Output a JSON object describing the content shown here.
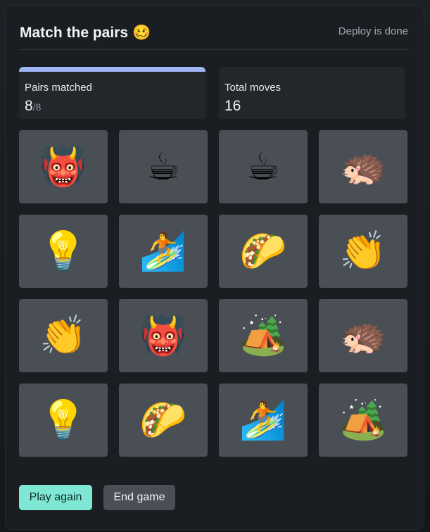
{
  "header": {
    "title": "Match the pairs",
    "title_emoji": "🥴",
    "status": "Deploy is done"
  },
  "stats": {
    "pairs_label": "Pairs matched",
    "pairs_value": "8",
    "pairs_total": "/8",
    "pairs_progress": 1.0,
    "moves_label": "Total moves",
    "moves_value": "16"
  },
  "tiles": [
    {
      "emoji": "👹",
      "icon": "ogre-icon"
    },
    {
      "emoji": "☕",
      "icon": "coffee-icon"
    },
    {
      "emoji": "☕",
      "icon": "coffee-icon"
    },
    {
      "emoji": "🦔",
      "icon": "hedgehog-icon"
    },
    {
      "emoji": "💡",
      "icon": "light-bulb-icon"
    },
    {
      "emoji": "🏄",
      "icon": "surfer-icon"
    },
    {
      "emoji": "🌮",
      "icon": "taco-icon"
    },
    {
      "emoji": "👏",
      "icon": "clapping-hands-icon"
    },
    {
      "emoji": "👏",
      "icon": "clapping-hands-icon"
    },
    {
      "emoji": "👹",
      "icon": "ogre-icon"
    },
    {
      "emoji": "🏕️",
      "icon": "camping-icon"
    },
    {
      "emoji": "🦔",
      "icon": "hedgehog-icon"
    },
    {
      "emoji": "💡",
      "icon": "light-bulb-icon"
    },
    {
      "emoji": "🌮",
      "icon": "taco-icon"
    },
    {
      "emoji": "🏄",
      "icon": "surfer-icon"
    },
    {
      "emoji": "🏕️",
      "icon": "camping-icon"
    }
  ],
  "actions": {
    "play_again": "Play again",
    "end_game": "End game"
  },
  "colors": {
    "accent": "#7ee8d4",
    "progress": "#9fb4f5",
    "tile": "#4a4f55"
  }
}
